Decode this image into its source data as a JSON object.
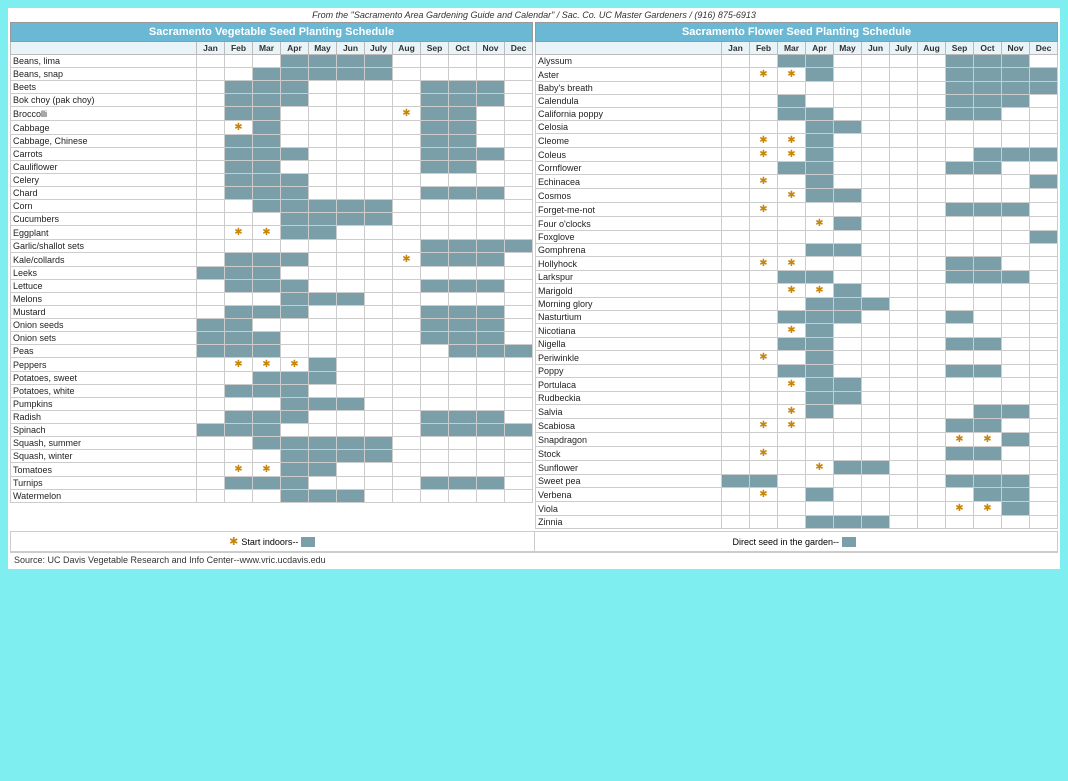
{
  "credit": "From the \"Sacramento Area Gardening Guide and Calendar\" / Sac. Co. UC Master Gardeners / (916) 875-6913",
  "source": "Source:  UC Davis Vegetable Research and Info Center--www.vric.ucdavis.edu",
  "veg_title": "Sacramento Vegetable Seed Planting Schedule",
  "flower_title": "Sacramento Flower Seed Planting Schedule",
  "months": [
    "Jan",
    "Feb",
    "Mar",
    "Apr",
    "May",
    "Jun",
    "July",
    "Aug",
    "Sep",
    "Oct",
    "Nov",
    "Dec"
  ],
  "legend_left": "Start indoors--",
  "legend_right": "Direct seed in the garden--",
  "vegetables": [
    {
      "name": "Beans, lima",
      "months": [
        0,
        0,
        0,
        1,
        1,
        1,
        1,
        0,
        0,
        0,
        0,
        0
      ]
    },
    {
      "name": "Beans, snap",
      "months": [
        0,
        0,
        1,
        1,
        1,
        1,
        1,
        0,
        0,
        0,
        0,
        0
      ]
    },
    {
      "name": "Beets",
      "months": [
        0,
        1,
        1,
        1,
        0,
        0,
        0,
        0,
        1,
        1,
        1,
        0
      ]
    },
    {
      "name": "Bok choy (pak choy)",
      "months": [
        0,
        1,
        1,
        1,
        0,
        0,
        0,
        0,
        1,
        1,
        1,
        0
      ]
    },
    {
      "name": "Broccolli",
      "months": [
        0,
        1,
        1,
        0,
        0,
        0,
        0,
        0,
        1,
        1,
        0,
        0
      ],
      "stars": [
        {
          "month": 7,
          "type": "star"
        }
      ]
    },
    {
      "name": "Cabbage",
      "months": [
        0,
        1,
        1,
        0,
        0,
        0,
        0,
        0,
        1,
        1,
        0,
        0
      ],
      "stars": [
        {
          "month": 1,
          "type": "star"
        }
      ]
    },
    {
      "name": "Cabbage, Chinese",
      "months": [
        0,
        1,
        1,
        0,
        0,
        0,
        0,
        0,
        1,
        1,
        0,
        0
      ]
    },
    {
      "name": "Carrots",
      "months": [
        0,
        1,
        1,
        1,
        0,
        0,
        0,
        0,
        1,
        1,
        1,
        0
      ]
    },
    {
      "name": "Cauliflower",
      "months": [
        0,
        1,
        1,
        0,
        0,
        0,
        0,
        0,
        1,
        1,
        0,
        0
      ]
    },
    {
      "name": "Celery",
      "months": [
        0,
        1,
        1,
        1,
        0,
        0,
        0,
        0,
        0,
        0,
        0,
        0
      ]
    },
    {
      "name": "Chard",
      "months": [
        0,
        1,
        1,
        1,
        0,
        0,
        0,
        0,
        1,
        1,
        1,
        0
      ]
    },
    {
      "name": "Corn",
      "months": [
        0,
        0,
        1,
        1,
        1,
        1,
        1,
        0,
        0,
        0,
        0,
        0
      ]
    },
    {
      "name": "Cucumbers",
      "months": [
        0,
        0,
        0,
        1,
        1,
        1,
        1,
        0,
        0,
        0,
        0,
        0
      ]
    },
    {
      "name": "Eggplant",
      "months": [
        0,
        0,
        0,
        1,
        1,
        0,
        0,
        0,
        0,
        0,
        0,
        0
      ],
      "stars": [
        {
          "month": 1,
          "type": "star"
        },
        {
          "month": 2,
          "type": "star"
        }
      ]
    },
    {
      "name": "Garlic/shallot sets",
      "months": [
        0,
        0,
        0,
        0,
        0,
        0,
        0,
        0,
        1,
        1,
        1,
        1
      ]
    },
    {
      "name": "Kale/collards",
      "months": [
        0,
        1,
        1,
        1,
        0,
        0,
        0,
        0,
        1,
        1,
        1,
        0
      ],
      "stars": [
        {
          "month": 7,
          "type": "star"
        }
      ]
    },
    {
      "name": "Leeks",
      "months": [
        1,
        1,
        1,
        0,
        0,
        0,
        0,
        0,
        0,
        0,
        0,
        0
      ]
    },
    {
      "name": "Lettuce",
      "months": [
        0,
        1,
        1,
        1,
        0,
        0,
        0,
        0,
        1,
        1,
        1,
        0
      ]
    },
    {
      "name": "Melons",
      "months": [
        0,
        0,
        0,
        1,
        1,
        1,
        0,
        0,
        0,
        0,
        0,
        0
      ]
    },
    {
      "name": "Mustard",
      "months": [
        0,
        1,
        1,
        1,
        0,
        0,
        0,
        0,
        1,
        1,
        1,
        0
      ]
    },
    {
      "name": "Onion seeds",
      "months": [
        1,
        1,
        0,
        0,
        0,
        0,
        0,
        0,
        1,
        1,
        1,
        0
      ]
    },
    {
      "name": "Onion sets",
      "months": [
        1,
        1,
        1,
        0,
        0,
        0,
        0,
        0,
        1,
        1,
        1,
        0
      ]
    },
    {
      "name": "Peas",
      "months": [
        1,
        1,
        1,
        0,
        0,
        0,
        0,
        0,
        0,
        1,
        1,
        1
      ]
    },
    {
      "name": "Peppers",
      "months": [
        0,
        0,
        0,
        1,
        1,
        0,
        0,
        0,
        0,
        0,
        0,
        0
      ],
      "stars": [
        {
          "month": 1,
          "type": "star"
        },
        {
          "month": 2,
          "type": "star"
        },
        {
          "month": 3,
          "type": "star"
        }
      ]
    },
    {
      "name": "Potatoes, sweet",
      "months": [
        0,
        0,
        1,
        1,
        1,
        0,
        0,
        0,
        0,
        0,
        0,
        0
      ]
    },
    {
      "name": "Potatoes, white",
      "months": [
        0,
        1,
        1,
        1,
        0,
        0,
        0,
        0,
        0,
        0,
        0,
        0
      ]
    },
    {
      "name": "Pumpkins",
      "months": [
        0,
        0,
        0,
        1,
        1,
        1,
        0,
        0,
        0,
        0,
        0,
        0
      ]
    },
    {
      "name": "Radish",
      "months": [
        0,
        1,
        1,
        1,
        0,
        0,
        0,
        0,
        1,
        1,
        1,
        0
      ]
    },
    {
      "name": "Spinach",
      "months": [
        1,
        1,
        1,
        0,
        0,
        0,
        0,
        0,
        1,
        1,
        1,
        1
      ]
    },
    {
      "name": "Squash, summer",
      "months": [
        0,
        0,
        1,
        1,
        1,
        1,
        1,
        0,
        0,
        0,
        0,
        0
      ]
    },
    {
      "name": "Squash, winter",
      "months": [
        0,
        0,
        0,
        1,
        1,
        1,
        1,
        0,
        0,
        0,
        0,
        0
      ]
    },
    {
      "name": "Tomatoes",
      "months": [
        0,
        0,
        0,
        1,
        1,
        0,
        0,
        0,
        0,
        0,
        0,
        0
      ],
      "stars": [
        {
          "month": 1,
          "type": "star"
        },
        {
          "month": 2,
          "type": "star"
        }
      ]
    },
    {
      "name": "Turnips",
      "months": [
        0,
        1,
        1,
        1,
        0,
        0,
        0,
        0,
        1,
        1,
        1,
        0
      ]
    },
    {
      "name": "Watermelon",
      "months": [
        0,
        0,
        0,
        1,
        1,
        1,
        0,
        0,
        0,
        0,
        0,
        0
      ]
    }
  ],
  "flowers": [
    {
      "name": "Alyssum",
      "months": [
        0,
        0,
        1,
        1,
        0,
        0,
        0,
        0,
        1,
        1,
        1,
        0
      ]
    },
    {
      "name": "Aster",
      "months": [
        0,
        0,
        0,
        1,
        0,
        0,
        0,
        0,
        1,
        1,
        1,
        1
      ],
      "stars": [
        {
          "month": 1,
          "type": "star"
        },
        {
          "month": 2,
          "type": "star"
        }
      ]
    },
    {
      "name": "Baby's breath",
      "months": [
        0,
        0,
        0,
        0,
        0,
        0,
        0,
        0,
        1,
        1,
        1,
        1
      ]
    },
    {
      "name": "Calendula",
      "months": [
        0,
        0,
        1,
        0,
        0,
        0,
        0,
        0,
        1,
        1,
        1,
        0
      ]
    },
    {
      "name": "California poppy",
      "months": [
        0,
        0,
        1,
        1,
        0,
        0,
        0,
        0,
        1,
        1,
        0,
        0
      ]
    },
    {
      "name": "Celosia",
      "months": [
        0,
        0,
        0,
        1,
        1,
        0,
        0,
        0,
        0,
        0,
        0,
        0
      ]
    },
    {
      "name": "Cleome",
      "months": [
        0,
        0,
        0,
        1,
        0,
        0,
        0,
        0,
        0,
        0,
        0,
        0
      ],
      "stars": [
        {
          "month": 1,
          "type": "star"
        },
        {
          "month": 2,
          "type": "star"
        }
      ]
    },
    {
      "name": "Coleus",
      "months": [
        0,
        0,
        0,
        1,
        0,
        0,
        0,
        0,
        0,
        1,
        1,
        1
      ],
      "stars": [
        {
          "month": 1,
          "type": "star"
        },
        {
          "month": 2,
          "type": "star"
        }
      ]
    },
    {
      "name": "Cornflower",
      "months": [
        0,
        0,
        1,
        1,
        0,
        0,
        0,
        0,
        1,
        1,
        0,
        0
      ]
    },
    {
      "name": "Echinacea",
      "months": [
        0,
        0,
        0,
        1,
        0,
        0,
        0,
        0,
        0,
        0,
        0,
        1
      ],
      "stars": [
        {
          "month": 1,
          "type": "star"
        }
      ]
    },
    {
      "name": "Cosmos",
      "months": [
        0,
        0,
        0,
        1,
        1,
        0,
        0,
        0,
        0,
        0,
        0,
        0
      ],
      "stars": [
        {
          "month": 2,
          "type": "star"
        }
      ]
    },
    {
      "name": "Forget-me-not",
      "months": [
        0,
        0,
        0,
        0,
        0,
        0,
        0,
        0,
        1,
        1,
        1,
        0
      ],
      "stars": [
        {
          "month": 1,
          "type": "star"
        }
      ]
    },
    {
      "name": "Four o'clocks",
      "months": [
        0,
        0,
        0,
        1,
        1,
        0,
        0,
        0,
        0,
        0,
        0,
        0
      ],
      "stars": [
        {
          "month": 3,
          "type": "star"
        }
      ]
    },
    {
      "name": "Foxglove",
      "months": [
        0,
        0,
        0,
        0,
        0,
        0,
        0,
        0,
        0,
        0,
        0,
        1
      ]
    },
    {
      "name": "Gomphrena",
      "months": [
        0,
        0,
        0,
        1,
        1,
        0,
        0,
        0,
        0,
        0,
        0,
        0
      ]
    },
    {
      "name": "Hollyhock",
      "months": [
        0,
        0,
        0,
        0,
        0,
        0,
        0,
        0,
        1,
        1,
        0,
        0
      ],
      "stars": [
        {
          "month": 1,
          "type": "star"
        },
        {
          "month": 2,
          "type": "star"
        }
      ]
    },
    {
      "name": "Larkspur",
      "months": [
        0,
        0,
        1,
        1,
        0,
        0,
        0,
        0,
        1,
        1,
        1,
        0
      ]
    },
    {
      "name": "Marigold",
      "months": [
        0,
        0,
        0,
        1,
        1,
        0,
        0,
        0,
        0,
        0,
        0,
        0
      ],
      "stars": [
        {
          "month": 2,
          "type": "star"
        },
        {
          "month": 3,
          "type": "star"
        }
      ]
    },
    {
      "name": "Morning glory",
      "months": [
        0,
        0,
        0,
        1,
        1,
        1,
        0,
        0,
        0,
        0,
        0,
        0
      ]
    },
    {
      "name": "Nasturtium",
      "months": [
        0,
        0,
        1,
        1,
        1,
        0,
        0,
        0,
        1,
        0,
        0,
        0
      ]
    },
    {
      "name": "Nicotiana",
      "months": [
        0,
        0,
        0,
        1,
        0,
        0,
        0,
        0,
        0,
        0,
        0,
        0
      ],
      "stars": [
        {
          "month": 2,
          "type": "star"
        }
      ]
    },
    {
      "name": "Nigella",
      "months": [
        0,
        0,
        1,
        1,
        0,
        0,
        0,
        0,
        1,
        1,
        0,
        0
      ]
    },
    {
      "name": "Periwinkle",
      "months": [
        0,
        0,
        0,
        1,
        0,
        0,
        0,
        0,
        0,
        0,
        0,
        0
      ],
      "stars": [
        {
          "month": 1,
          "type": "star"
        }
      ]
    },
    {
      "name": "Poppy",
      "months": [
        0,
        0,
        1,
        1,
        0,
        0,
        0,
        0,
        1,
        1,
        0,
        0
      ]
    },
    {
      "name": "Portulaca",
      "months": [
        0,
        0,
        0,
        1,
        1,
        0,
        0,
        0,
        0,
        0,
        0,
        0
      ],
      "stars": [
        {
          "month": 2,
          "type": "star"
        }
      ]
    },
    {
      "name": "Rudbeckia",
      "months": [
        0,
        0,
        0,
        1,
        1,
        0,
        0,
        0,
        0,
        0,
        0,
        0
      ]
    },
    {
      "name": "Salvia",
      "months": [
        0,
        0,
        0,
        1,
        0,
        0,
        0,
        0,
        0,
        1,
        1,
        0
      ],
      "stars": [
        {
          "month": 2,
          "type": "star"
        }
      ]
    },
    {
      "name": "Scabiosa",
      "months": [
        0,
        0,
        0,
        0,
        0,
        0,
        0,
        0,
        1,
        1,
        0,
        0
      ],
      "stars": [
        {
          "month": 1,
          "type": "star"
        },
        {
          "month": 2,
          "type": "star"
        }
      ]
    },
    {
      "name": "Snapdragon",
      "months": [
        0,
        0,
        0,
        0,
        0,
        0,
        0,
        0,
        1,
        1,
        1,
        0
      ],
      "stars": [
        {
          "month": 8,
          "type": "star"
        },
        {
          "month": 9,
          "type": "star"
        }
      ]
    },
    {
      "name": "Stock",
      "months": [
        0,
        0,
        0,
        0,
        0,
        0,
        0,
        0,
        1,
        1,
        0,
        0
      ],
      "stars": [
        {
          "month": 1,
          "type": "star"
        }
      ]
    },
    {
      "name": "Sunflower",
      "months": [
        0,
        0,
        0,
        1,
        1,
        1,
        0,
        0,
        0,
        0,
        0,
        0
      ],
      "stars": [
        {
          "month": 3,
          "type": "star"
        }
      ]
    },
    {
      "name": "Sweet pea",
      "months": [
        1,
        1,
        0,
        0,
        0,
        0,
        0,
        0,
        1,
        1,
        1,
        0
      ]
    },
    {
      "name": "Verbena",
      "months": [
        0,
        0,
        0,
        1,
        0,
        0,
        0,
        0,
        0,
        1,
        1,
        0
      ],
      "stars": [
        {
          "month": 1,
          "type": "star"
        }
      ]
    },
    {
      "name": "Viola",
      "months": [
        0,
        0,
        0,
        0,
        0,
        0,
        0,
        0,
        1,
        1,
        1,
        0
      ],
      "stars": [
        {
          "month": 8,
          "type": "star"
        },
        {
          "month": 9,
          "type": "star"
        }
      ]
    },
    {
      "name": "Zinnia",
      "months": [
        0,
        0,
        0,
        1,
        1,
        1,
        0,
        0,
        0,
        0,
        0,
        0
      ]
    }
  ]
}
